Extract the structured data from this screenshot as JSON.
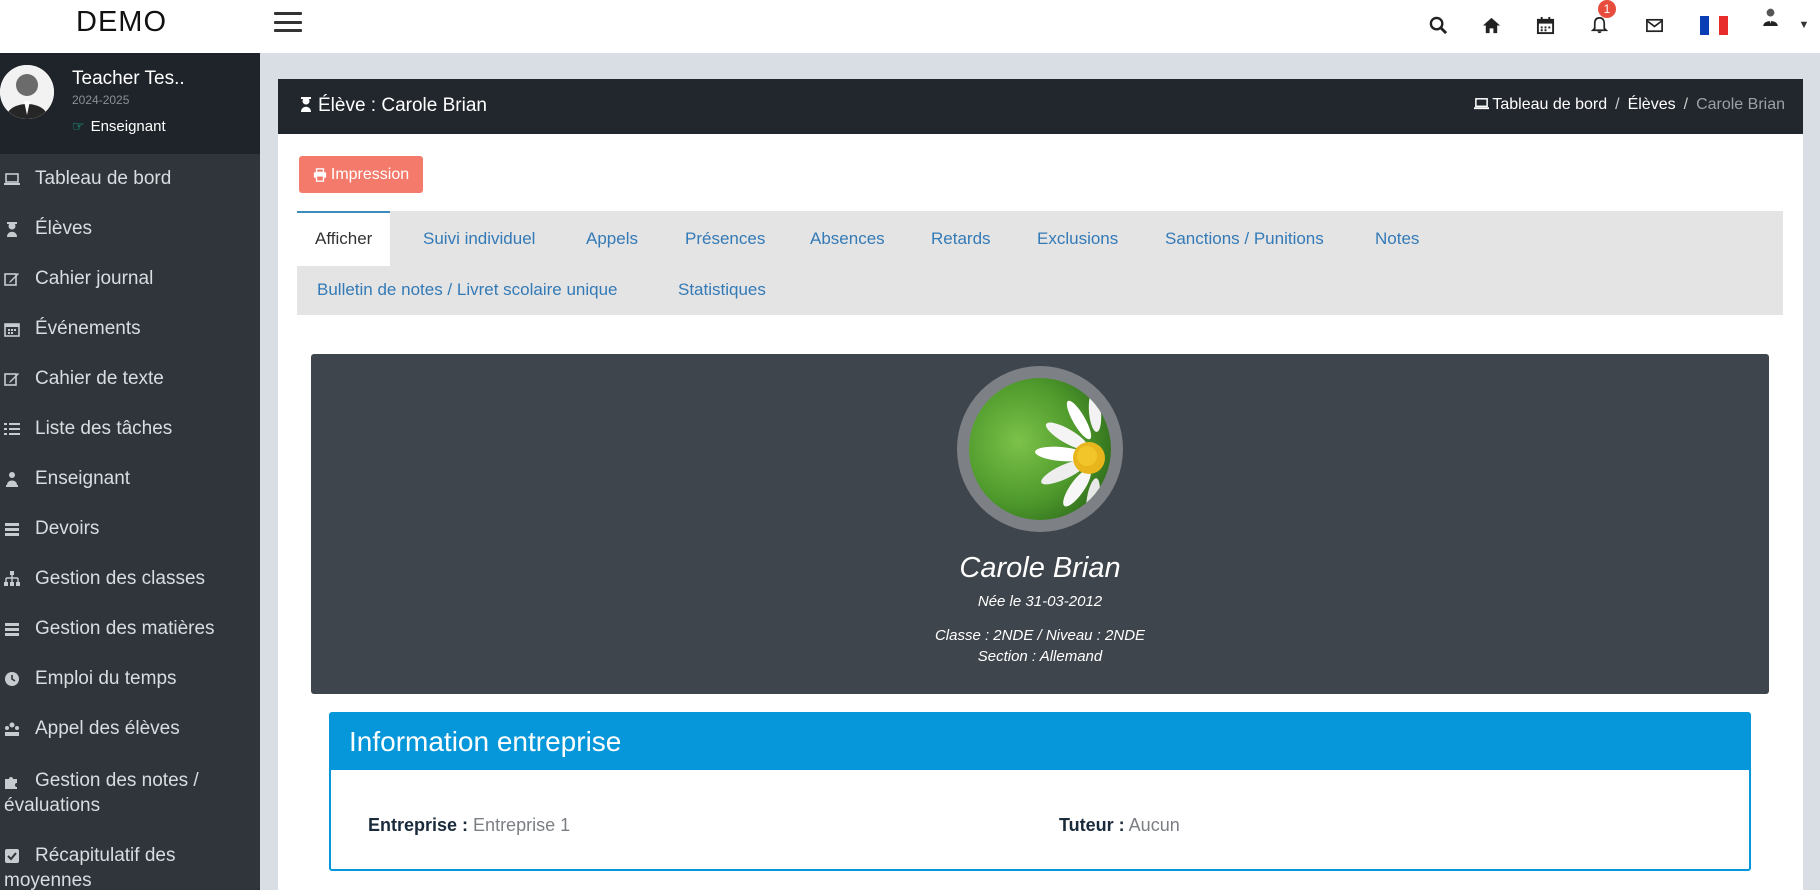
{
  "app": {
    "logo": "DEMO"
  },
  "topbar": {
    "icons": [
      "search-icon",
      "home-icon",
      "calendar-icon",
      "bell-icon",
      "mail-icon",
      "flag-fr-icon",
      "user-avatar"
    ],
    "notification_count": "1"
  },
  "sidebar": {
    "user_name": "Teacher Tes..",
    "year": "2024-2025",
    "role": "Enseignant",
    "items": [
      {
        "label": "Tableau de bord",
        "icon": "laptop-icon"
      },
      {
        "label": "Élèves",
        "icon": "student-icon"
      },
      {
        "label": "Cahier journal",
        "icon": "edit-icon"
      },
      {
        "label": "Événements",
        "icon": "calendar-icon"
      },
      {
        "label": "Cahier de texte",
        "icon": "edit-icon"
      },
      {
        "label": "Liste des tâches",
        "icon": "list-icon"
      },
      {
        "label": "Enseignant",
        "icon": "teacher-icon"
      },
      {
        "label": "Devoirs",
        "icon": "stack-icon"
      },
      {
        "label": "Gestion des classes",
        "icon": "sitemap-icon"
      },
      {
        "label": "Gestion des matières",
        "icon": "stack-icon"
      },
      {
        "label": "Emploi du temps",
        "icon": "clock-icon"
      },
      {
        "label": "Appel des élèves",
        "icon": "group-icon"
      },
      {
        "label": "Gestion des notes / évaluations",
        "icon": "puzzle-icon"
      },
      {
        "label": "Récapitulatif des moyennes",
        "icon": "check-square-icon"
      }
    ]
  },
  "header": {
    "title": "Élève : Carole Brian",
    "breadcrumb": [
      "Tableau de bord",
      "Élèves",
      "Carole Brian"
    ]
  },
  "actions": {
    "print_label": "Impression"
  },
  "tabs": [
    "Afficher",
    "Suivi individuel",
    "Appels",
    "Présences",
    "Absences",
    "Retards",
    "Exclusions",
    "Sanctions / Punitions",
    "Notes",
    "Bulletin de notes / Livret scolaire unique",
    "Statistiques"
  ],
  "student": {
    "name": "Carole Brian",
    "birth": "Née le 31-03-2012",
    "class_level": "Classe : 2NDE / Niveau : 2NDE",
    "section": "Section : Allemand"
  },
  "company": {
    "heading": "Information entreprise",
    "company_label": "Entreprise :",
    "company_value": "Entreprise 1",
    "tutor_label": "Tuteur :",
    "tutor_value": "Aucun"
  },
  "colors": {
    "sidebar": "#2f353b",
    "header": "#22272d",
    "print_button": "#f47a6c",
    "info_accent": "#0597d9",
    "link": "#337ab7"
  }
}
